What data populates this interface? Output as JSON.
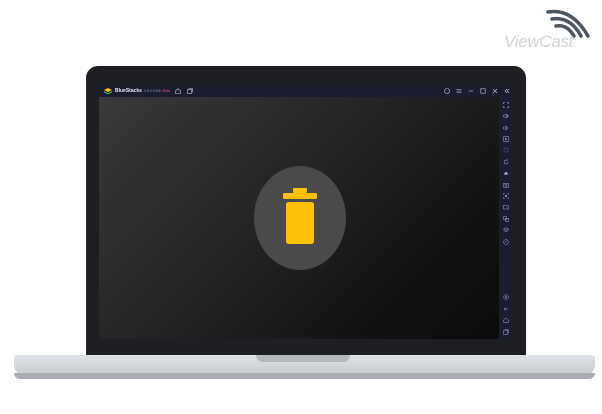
{
  "logo": {
    "text": "ViewCast"
  },
  "window": {
    "app_name": "BlueStacks",
    "version": "5.8.0.1008",
    "tag": "Beta",
    "titlebar_left_icons": [
      "home-icon",
      "multi-instance-icon"
    ],
    "titlebar_right_icons": [
      "help-icon",
      "menu-icon",
      "minimize-icon",
      "restore-icon",
      "close-icon",
      "collapse-sidebar-icon"
    ],
    "sidebar_icons": [
      "fullscreen-icon",
      "volume-up-icon",
      "volume-down-icon",
      "media-icon",
      "lock-cursor-icon",
      "rotate-icon",
      "shake-icon",
      "screenshot-icon",
      "screen-record-icon",
      "folder-icon",
      "copy-icon",
      "layers-icon",
      "eco-icon",
      "settings-icon",
      "back-icon",
      "home-icon",
      "recent-apps-icon"
    ]
  },
  "colors": {
    "accent": "#FFC107",
    "titlebar": "#1A1D2E",
    "lid": "#1E1F23",
    "trash_bg": "#4A4A4A"
  },
  "center_icon": "trash-icon"
}
